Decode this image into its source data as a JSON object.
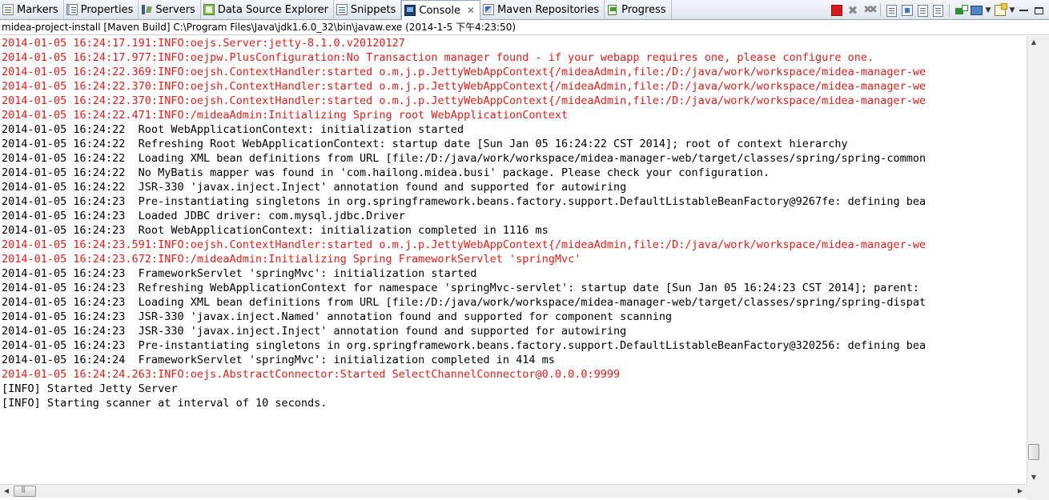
{
  "tabs": [
    {
      "label": "Markers",
      "icon": "markers-icon",
      "active": false
    },
    {
      "label": "Properties",
      "icon": "properties-icon",
      "active": false
    },
    {
      "label": "Servers",
      "icon": "servers-icon",
      "active": false
    },
    {
      "label": "Data Source Explorer",
      "icon": "data-source-explorer-icon",
      "active": false
    },
    {
      "label": "Snippets",
      "icon": "snippets-icon",
      "active": false
    },
    {
      "label": "Console",
      "icon": "console-icon",
      "active": true,
      "close": "✕"
    },
    {
      "label": "Maven Repositories",
      "icon": "maven-repositories-icon",
      "active": false
    },
    {
      "label": "Progress",
      "icon": "progress-icon",
      "active": false
    }
  ],
  "toolbar": {
    "buttons": [
      "terminate-icon",
      "remove-launch-icon",
      "remove-all-terminated-icon",
      "clear-console-icon",
      "scroll-lock-icon",
      "show-console-on-stdout-icon",
      "show-console-on-stderr-icon",
      "pin-console-icon",
      "display-selected-console-icon",
      "open-console-icon",
      "minimize-icon",
      "maximize-icon"
    ],
    "dropdown_glyph": "▼"
  },
  "process_label": "midea-project-install [Maven Build] C:\\Program Files\\Java\\jdk1.6.0_32\\bin\\javaw.exe (2014-1-5 下午4:23:50)",
  "colors": {
    "stderr": "#e0201b",
    "stdout": "#000000"
  },
  "console_lines": [
    {
      "stream": "err",
      "text": "2014-01-05 16:24:17.191:INFO:oejs.Server:jetty-8.1.0.v20120127"
    },
    {
      "stream": "err",
      "text": "2014-01-05 16:24:17.977:INFO:oejpw.PlusConfiguration:No Transaction manager found - if your webapp requires one, please configure one."
    },
    {
      "stream": "err",
      "text": "2014-01-05 16:24:22.369:INFO:oejsh.ContextHandler:started o.m.j.p.JettyWebAppContext{/mideaAdmin,file:/D:/java/work/workspace/midea-manager-we"
    },
    {
      "stream": "err",
      "text": "2014-01-05 16:24:22.370:INFO:oejsh.ContextHandler:started o.m.j.p.JettyWebAppContext{/mideaAdmin,file:/D:/java/work/workspace/midea-manager-we"
    },
    {
      "stream": "err",
      "text": "2014-01-05 16:24:22.370:INFO:oejsh.ContextHandler:started o.m.j.p.JettyWebAppContext{/mideaAdmin,file:/D:/java/work/workspace/midea-manager-we"
    },
    {
      "stream": "err",
      "text": "2014-01-05 16:24:22.471:INFO:/mideaAdmin:Initializing Spring root WebApplicationContext"
    },
    {
      "stream": "out",
      "text": "2014-01-05 16:24:22  Root WebApplicationContext: initialization started"
    },
    {
      "stream": "out",
      "text": "2014-01-05 16:24:22  Refreshing Root WebApplicationContext: startup date [Sun Jan 05 16:24:22 CST 2014]; root of context hierarchy"
    },
    {
      "stream": "out",
      "text": "2014-01-05 16:24:22  Loading XML bean definitions from URL [file:/D:/java/work/workspace/midea-manager-web/target/classes/spring/spring-common"
    },
    {
      "stream": "out",
      "text": "2014-01-05 16:24:22  No MyBatis mapper was found in 'com.hailong.midea.busi' package. Please check your configuration."
    },
    {
      "stream": "out",
      "text": "2014-01-05 16:24:22  JSR-330 'javax.inject.Inject' annotation found and supported for autowiring"
    },
    {
      "stream": "out",
      "text": "2014-01-05 16:24:23  Pre-instantiating singletons in org.springframework.beans.factory.support.DefaultListableBeanFactory@9267fe: defining bea"
    },
    {
      "stream": "out",
      "text": "2014-01-05 16:24:23  Loaded JDBC driver: com.mysql.jdbc.Driver"
    },
    {
      "stream": "out",
      "text": "2014-01-05 16:24:23  Root WebApplicationContext: initialization completed in 1116 ms"
    },
    {
      "stream": "err",
      "text": "2014-01-05 16:24:23.591:INFO:oejsh.ContextHandler:started o.m.j.p.JettyWebAppContext{/mideaAdmin,file:/D:/java/work/workspace/midea-manager-we"
    },
    {
      "stream": "err",
      "text": "2014-01-05 16:24:23.672:INFO:/mideaAdmin:Initializing Spring FrameworkServlet 'springMvc'"
    },
    {
      "stream": "out",
      "text": "2014-01-05 16:24:23  FrameworkServlet 'springMvc': initialization started"
    },
    {
      "stream": "out",
      "text": "2014-01-05 16:24:23  Refreshing WebApplicationContext for namespace 'springMvc-servlet': startup date [Sun Jan 05 16:24:23 CST 2014]; parent: "
    },
    {
      "stream": "out",
      "text": "2014-01-05 16:24:23  Loading XML bean definitions from URL [file:/D:/java/work/workspace/midea-manager-web/target/classes/spring/spring-dispat"
    },
    {
      "stream": "out",
      "text": "2014-01-05 16:24:23  JSR-330 'javax.inject.Named' annotation found and supported for component scanning"
    },
    {
      "stream": "out",
      "text": "2014-01-05 16:24:23  JSR-330 'javax.inject.Inject' annotation found and supported for autowiring"
    },
    {
      "stream": "out",
      "text": "2014-01-05 16:24:23  Pre-instantiating singletons in org.springframework.beans.factory.support.DefaultListableBeanFactory@320256: defining bea"
    },
    {
      "stream": "out",
      "text": "2014-01-05 16:24:24  FrameworkServlet 'springMvc': initialization completed in 414 ms"
    },
    {
      "stream": "err",
      "text": "2014-01-05 16:24:24.263:INFO:oejs.AbstractConnector:Started SelectChannelConnector@0.0.0.0:9999"
    },
    {
      "stream": "out",
      "text": "[INFO] Started Jetty Server"
    },
    {
      "stream": "out",
      "text": "[INFO] Starting scanner at interval of 10 seconds."
    }
  ],
  "scrollbars": {
    "up": "▲",
    "down": "▼",
    "left": "◀",
    "right": "▶"
  }
}
